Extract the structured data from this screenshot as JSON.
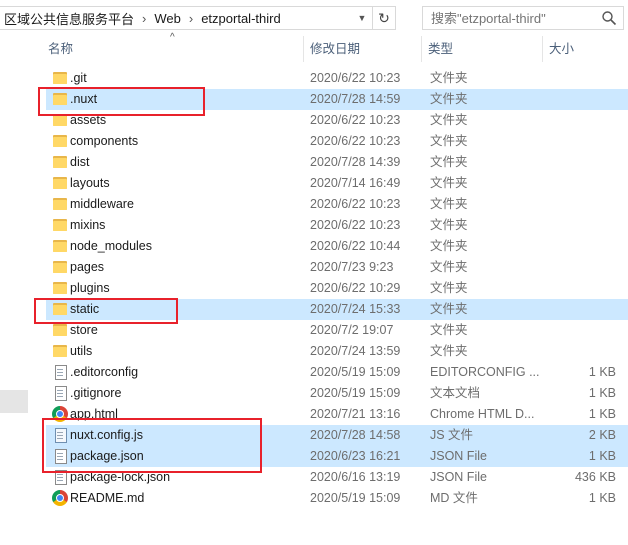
{
  "address": {
    "crumbs": [
      "区域公共信息服务平台",
      "Web",
      "etzportal-third"
    ]
  },
  "search": {
    "placeholder": "搜索\"etzportal-third\""
  },
  "columns": {
    "name": "名称",
    "date": "修改日期",
    "type": "类型",
    "size": "大小"
  },
  "files": [
    {
      "name": ".git",
      "date": "2020/6/22 10:23",
      "type": "文件夹",
      "size": "",
      "icon": "folder-icon",
      "selected": false
    },
    {
      "name": ".nuxt",
      "date": "2020/7/28 14:59",
      "type": "文件夹",
      "size": "",
      "icon": "folder-icon",
      "selected": true
    },
    {
      "name": "assets",
      "date": "2020/6/22 10:23",
      "type": "文件夹",
      "size": "",
      "icon": "folder-icon",
      "selected": false
    },
    {
      "name": "components",
      "date": "2020/6/22 10:23",
      "type": "文件夹",
      "size": "",
      "icon": "folder-icon",
      "selected": false
    },
    {
      "name": "dist",
      "date": "2020/7/28 14:39",
      "type": "文件夹",
      "size": "",
      "icon": "folder-icon",
      "selected": false
    },
    {
      "name": "layouts",
      "date": "2020/7/14 16:49",
      "type": "文件夹",
      "size": "",
      "icon": "folder-icon",
      "selected": false
    },
    {
      "name": "middleware",
      "date": "2020/6/22 10:23",
      "type": "文件夹",
      "size": "",
      "icon": "folder-icon",
      "selected": false
    },
    {
      "name": "mixins",
      "date": "2020/6/22 10:23",
      "type": "文件夹",
      "size": "",
      "icon": "folder-icon",
      "selected": false
    },
    {
      "name": "node_modules",
      "date": "2020/6/22 10:44",
      "type": "文件夹",
      "size": "",
      "icon": "folder-icon",
      "selected": false
    },
    {
      "name": "pages",
      "date": "2020/7/23 9:23",
      "type": "文件夹",
      "size": "",
      "icon": "folder-icon",
      "selected": false
    },
    {
      "name": "plugins",
      "date": "2020/6/22 10:29",
      "type": "文件夹",
      "size": "",
      "icon": "folder-icon",
      "selected": false
    },
    {
      "name": "static",
      "date": "2020/7/24 15:33",
      "type": "文件夹",
      "size": "",
      "icon": "folder-icon",
      "selected": true
    },
    {
      "name": "store",
      "date": "2020/7/2 19:07",
      "type": "文件夹",
      "size": "",
      "icon": "folder-icon",
      "selected": false
    },
    {
      "name": "utils",
      "date": "2020/7/24 13:59",
      "type": "文件夹",
      "size": "",
      "icon": "folder-icon",
      "selected": false
    },
    {
      "name": ".editorconfig",
      "date": "2020/5/19 15:09",
      "type": "EDITORCONFIG ...",
      "size": "1 KB",
      "icon": "file-icon",
      "selected": false
    },
    {
      "name": ".gitignore",
      "date": "2020/5/19 15:09",
      "type": "文本文档",
      "size": "1 KB",
      "icon": "file-icon",
      "selected": false
    },
    {
      "name": "app.html",
      "date": "2020/7/21 13:16",
      "type": "Chrome HTML D...",
      "size": "1 KB",
      "icon": "chrome-icon",
      "selected": false
    },
    {
      "name": "nuxt.config.js",
      "date": "2020/7/28 14:58",
      "type": "JS 文件",
      "size": "2 KB",
      "icon": "js-file-icon",
      "selected": true
    },
    {
      "name": "package.json",
      "date": "2020/6/23 16:21",
      "type": "JSON File",
      "size": "1 KB",
      "icon": "file-icon",
      "selected": true
    },
    {
      "name": "package-lock.json",
      "date": "2020/6/16 13:19",
      "type": "JSON File",
      "size": "436 KB",
      "icon": "file-icon",
      "selected": false
    },
    {
      "name": "README.md",
      "date": "2020/5/19 15:09",
      "type": "MD 文件",
      "size": "1 KB",
      "icon": "chrome-icon",
      "selected": false
    }
  ]
}
